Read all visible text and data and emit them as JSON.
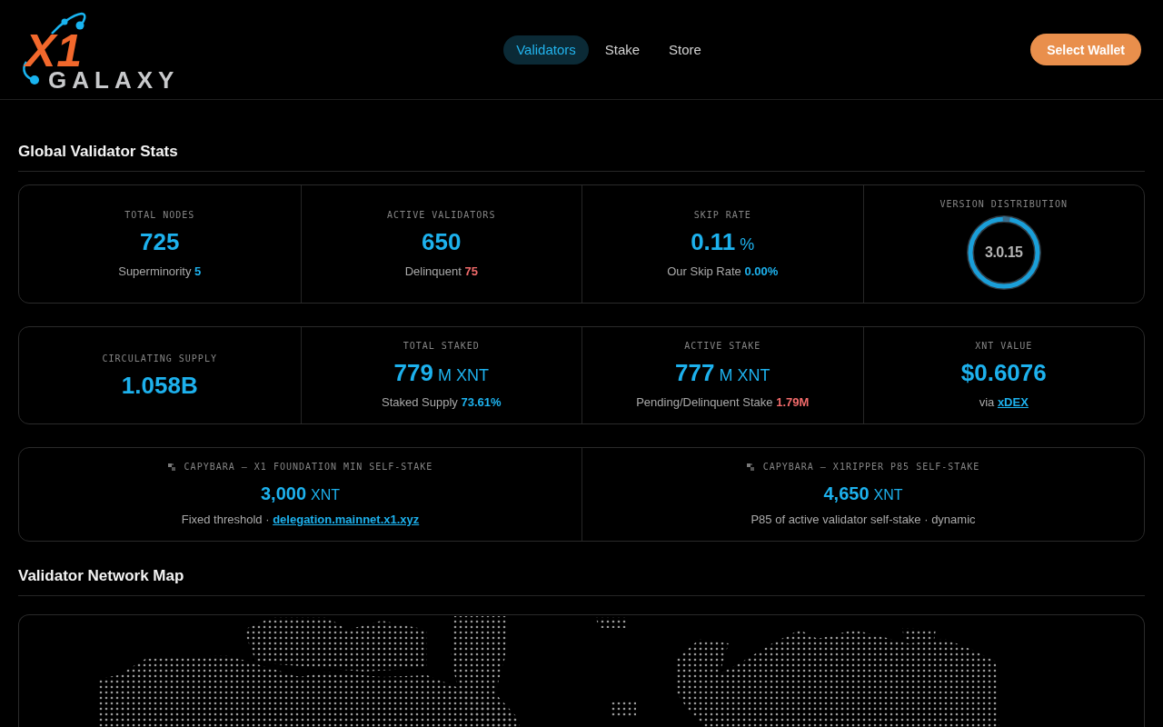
{
  "header": {
    "logo": {
      "mark": "X1",
      "wordmark": "GALAXY"
    },
    "nav": [
      {
        "label": "Validators",
        "selected": true
      },
      {
        "label": "Stake",
        "selected": false
      },
      {
        "label": "Store",
        "selected": false
      }
    ],
    "wallet_button": "Select Wallet"
  },
  "stats": {
    "title": "Global Validator Stats",
    "panels": [
      {
        "cells": [
          {
            "kind": "stat",
            "label": "TOTAL NODES",
            "value": "725",
            "note": {
              "text": "Superminority",
              "highlight": {
                "kind": "accent",
                "text": "5"
              }
            }
          },
          {
            "kind": "stat",
            "label": "ACTIVE VALIDATORS",
            "value": "650",
            "note": {
              "text": "Delinquent",
              "highlight": {
                "kind": "alert",
                "text": "75"
              }
            }
          },
          {
            "kind": "stat",
            "label": "SKIP RATE",
            "value": "0.11",
            "unit": "%",
            "note": {
              "text": "Our Skip Rate",
              "highlight": {
                "kind": "accent",
                "text": "0.00%"
              }
            }
          },
          {
            "kind": "version",
            "label": "VERSION DISTRIBUTION",
            "value": "3.0.15"
          }
        ]
      },
      {
        "cells": [
          {
            "kind": "stat",
            "label": "CIRCULATING SUPPLY",
            "value": "1.058B"
          },
          {
            "kind": "stat",
            "label": "TOTAL STAKED",
            "value": "779",
            "unit": "M XNT",
            "note": {
              "text": "Staked Supply",
              "highlight": {
                "kind": "accent",
                "text": "73.61%"
              }
            }
          },
          {
            "kind": "stat",
            "label": "ACTIVE STAKE",
            "value": "777",
            "unit": "M XNT",
            "note": {
              "text": "Pending/Delinquent Stake",
              "highlight": {
                "kind": "alert",
                "text": "1.79M"
              }
            }
          },
          {
            "kind": "stat",
            "label": "XNT VALUE",
            "value": "$0.6076",
            "note": {
              "text": "via",
              "highlight": {
                "kind": "link",
                "text": "xDEX"
              }
            }
          }
        ]
      },
      {
        "cells": [
          {
            "kind": "threshold",
            "label": "CAPYBARA — X1 FOUNDATION MIN SELF-STAKE",
            "value": "3,000",
            "unit": "XNT",
            "note": {
              "text": "Fixed threshold ·",
              "highlight": {
                "kind": "link",
                "text": "delegation.mainnet.x1.xyz"
              }
            }
          },
          {
            "kind": "threshold",
            "label": "CAPYBARA — X1RIPPER P85 SELF-STAKE",
            "value": "4,650",
            "unit": "XNT",
            "note": {
              "text": "P85 of active validator self-stake · dynamic"
            }
          }
        ]
      }
    ]
  },
  "network_map": {
    "title": "Validator Network Map"
  }
}
